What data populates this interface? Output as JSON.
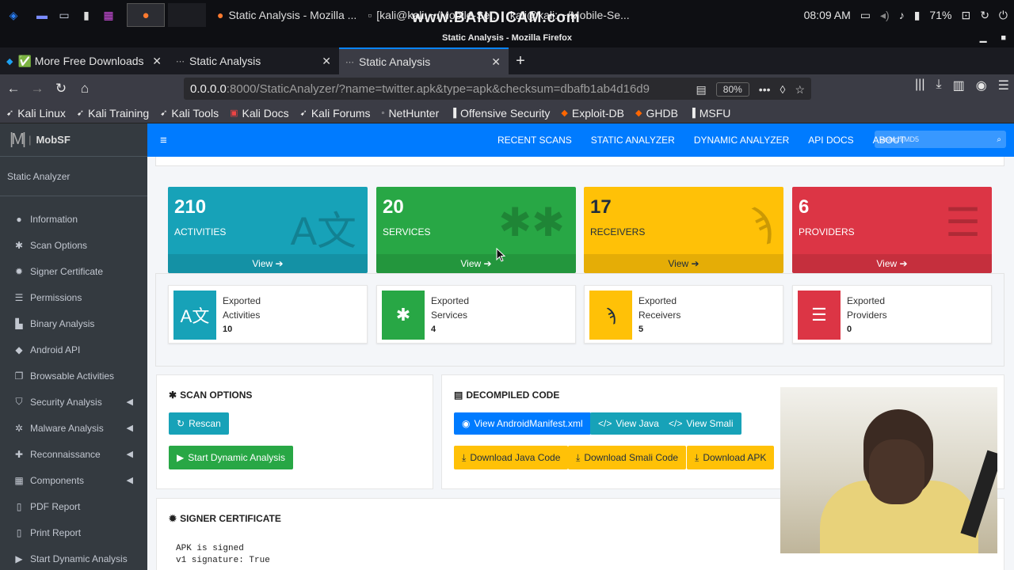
{
  "taskbar": {
    "tasks": [
      {
        "title": "Static Analysis - Mozilla ..."
      },
      {
        "title": "[kali@kali: ~/Mobile-Se..."
      },
      {
        "title": "kali@kali: ~/Mobile-Se..."
      }
    ],
    "clock": "08:09 AM",
    "battery": "71%",
    "watermark": "www.BANDICAM.com"
  },
  "window": {
    "title": "Static Analysis - Mozilla Firefox"
  },
  "browser": {
    "tabs": [
      {
        "label": "✅ More Free Downloads",
        "active": false
      },
      {
        "label": "Static Analysis",
        "active": false
      },
      {
        "label": "Static Analysis",
        "active": true
      }
    ],
    "url_host": "0.0.0.0",
    "url_rest": ":8000/StaticAnalyzer/?name=twitter.apk&type=apk&checksum=dbafb1ab4d16d9",
    "zoom": "80%",
    "bookmarks": [
      "Kali Linux",
      "Kali Training",
      "Kali Tools",
      "Kali Docs",
      "Kali Forums",
      "NetHunter",
      "Offensive Security",
      "Exploit-DB",
      "GHDB",
      "MSFU"
    ]
  },
  "mobsf": {
    "brand": "MobSF",
    "sidebar_heading": "Static Analyzer",
    "sidebar": [
      {
        "label": "Information",
        "icon": "info-circle-icon",
        "arrow": false
      },
      {
        "label": "Scan Options",
        "icon": "cog-icon",
        "arrow": false
      },
      {
        "label": "Signer Certificate",
        "icon": "certificate-icon",
        "arrow": false
      },
      {
        "label": "Permissions",
        "icon": "list-icon",
        "arrow": false
      },
      {
        "label": "Binary Analysis",
        "icon": "bookmark-icon",
        "arrow": false
      },
      {
        "label": "Android API",
        "icon": "android-icon",
        "arrow": false
      },
      {
        "label": "Browsable Activities",
        "icon": "clone-icon",
        "arrow": false
      },
      {
        "label": "Security Analysis",
        "icon": "shield-icon",
        "arrow": true
      },
      {
        "label": "Malware Analysis",
        "icon": "bug-icon",
        "arrow": true
      },
      {
        "label": "Reconnaissance",
        "icon": "plus-icon",
        "arrow": true
      },
      {
        "label": "Components",
        "icon": "th-icon",
        "arrow": true
      },
      {
        "label": "PDF Report",
        "icon": "file-pdf-icon",
        "arrow": false
      },
      {
        "label": "Print Report",
        "icon": "print-icon",
        "arrow": false
      },
      {
        "label": "Start Dynamic Analysis",
        "icon": "play-icon",
        "arrow": false
      }
    ],
    "menu": [
      "RECENT SCANS",
      "STATIC ANALYZER",
      "DYNAMIC ANALYZER",
      "API DOCS",
      "ABOUT"
    ],
    "search_placeholder": "Search MD5",
    "stats": [
      {
        "count": "210",
        "label": "ACTIVITIES",
        "view": "View",
        "color": "#17a2b8"
      },
      {
        "count": "20",
        "label": "SERVICES",
        "view": "View",
        "color": "#28a745"
      },
      {
        "count": "17",
        "label": "RECEIVERS",
        "view": "View",
        "color": "#ffc107"
      },
      {
        "count": "6",
        "label": "PROVIDERS",
        "view": "View",
        "color": "#dc3545"
      }
    ],
    "exported": [
      {
        "line1": "Exported",
        "line2": "Activities",
        "count": "10",
        "color": "#17a2b8"
      },
      {
        "line1": "Exported",
        "line2": "Services",
        "count": "4",
        "color": "#28a745"
      },
      {
        "line1": "Exported",
        "line2": "Receivers",
        "count": "5",
        "color": "#ffc107"
      },
      {
        "line1": "Exported",
        "line2": "Providers",
        "count": "0",
        "color": "#dc3545"
      }
    ],
    "scan_options": {
      "title": "SCAN OPTIONS",
      "rescan": "Rescan",
      "start_dynamic": "Start Dynamic Analysis"
    },
    "decompiled": {
      "title": "DECOMPILED CODE",
      "view_manifest": "View AndroidManifest.xml",
      "view_java": "View Java",
      "view_smali": "View Smali",
      "download_java": "Download Java Code",
      "download_smali": "Download Smali Code",
      "download_apk": "Download APK"
    },
    "signer": {
      "title": "SIGNER CERTIFICATE",
      "line1": "APK is signed",
      "line2": "v1 signature: True"
    }
  }
}
